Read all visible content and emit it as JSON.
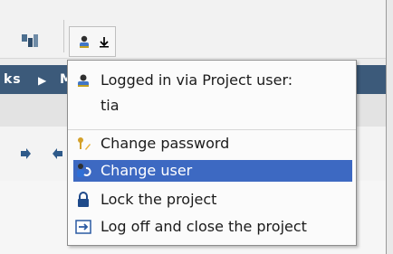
{
  "toolbar": {
    "user_button_title": "User",
    "nav_text": "ks",
    "nav_after": "M"
  },
  "menu": {
    "logged_in_label": "Logged in via Project user:",
    "username": "tia",
    "items": [
      {
        "label": "Change password",
        "icon": "key-pencil-icon",
        "selected": false
      },
      {
        "label": "Change user",
        "icon": "user-switch-icon",
        "selected": true
      },
      {
        "label": "Lock the project",
        "icon": "lock-icon",
        "selected": false
      },
      {
        "label": "Log off and close the project",
        "icon": "logoff-icon",
        "selected": false
      }
    ]
  },
  "colors": {
    "selection": "#3d69c2",
    "navbar": "#3c5a7a"
  }
}
